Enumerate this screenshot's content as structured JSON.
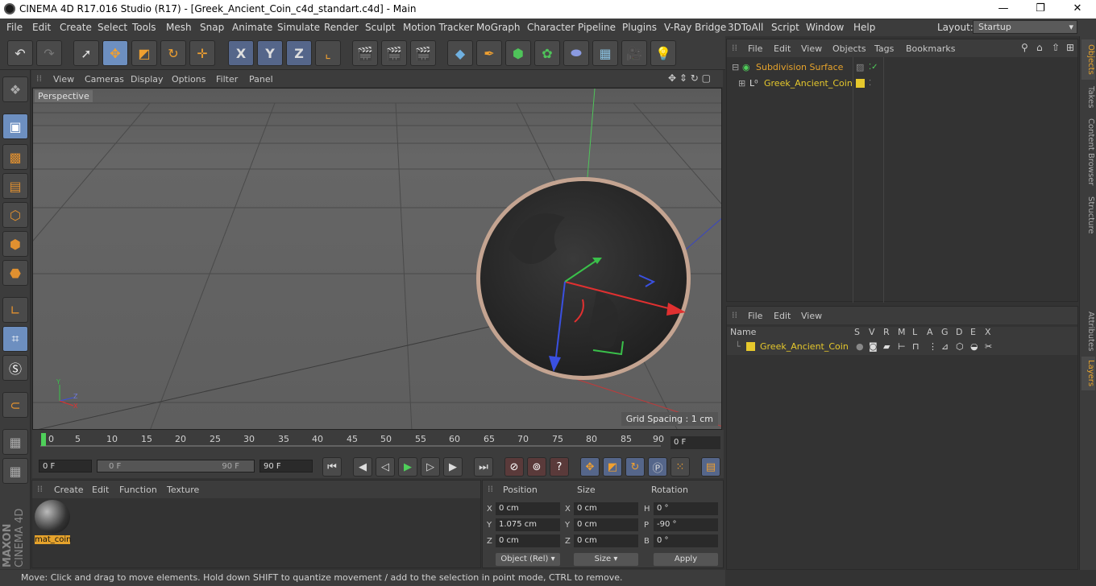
{
  "window": {
    "title": "CINEMA 4D R17.016 Studio (R17) - [Greek_Ancient_Coin_c4d_standart.c4d] - Main",
    "minimize": "—",
    "maximize": "❐",
    "close": "✕"
  },
  "menubar": {
    "items": [
      "File",
      "Edit",
      "Create",
      "Select",
      "Tools",
      "Mesh",
      "Snap",
      "Animate",
      "Simulate",
      "Render",
      "Sculpt",
      "Motion Tracker",
      "MoGraph",
      "Character",
      "Pipeline",
      "Plugins",
      "V-Ray Bridge",
      "3DToAll",
      "Script",
      "Window",
      "Help"
    ],
    "layout_label": "Layout:",
    "layout_value": "Startup"
  },
  "toolbar": {
    "undo": "↶",
    "redo": "↷",
    "axis_x": "X",
    "axis_y": "Y",
    "axis_z": "Z"
  },
  "viewport": {
    "menu": [
      "View",
      "Cameras",
      "Display",
      "Options",
      "Filter",
      "Panel"
    ],
    "label": "Perspective",
    "grid_spacing": "Grid Spacing : 1 cm",
    "axis_y": "Y",
    "axis_z": "Z",
    "axis_x": "X"
  },
  "timeline": {
    "ticks": [
      "0",
      "5",
      "10",
      "15",
      "20",
      "25",
      "30",
      "35",
      "40",
      "45",
      "50",
      "55",
      "60",
      "65",
      "70",
      "75",
      "80",
      "85",
      "90"
    ],
    "current_frame": "0 F"
  },
  "transport": {
    "start_field": "0 F",
    "range_start": "0 F",
    "range_end": "90 F",
    "end_field": "90 F"
  },
  "material_manager": {
    "menu": [
      "Create",
      "Edit",
      "Function",
      "Texture"
    ],
    "material_name": "mat_coin"
  },
  "coordinates": {
    "headers": {
      "position": "Position",
      "size": "Size",
      "rotation": "Rotation"
    },
    "pos_x": "0 cm",
    "pos_y": "1.075 cm",
    "pos_z": "0 cm",
    "size_x": "0 cm",
    "size_y": "0 cm",
    "size_z": "0 cm",
    "rot_h": "0 °",
    "rot_p": "-90 °",
    "rot_b": "0 °",
    "labels": {
      "x": "X",
      "y": "Y",
      "z": "Z",
      "h": "H",
      "p": "P",
      "b": "B"
    },
    "mode": "Object (Rel)",
    "size_mode": "Size",
    "apply": "Apply"
  },
  "status": {
    "text": "Move: Click and drag to move elements. Hold down SHIFT to quantize movement / add to the selection in point mode, CTRL to remove."
  },
  "object_manager": {
    "menu": [
      "File",
      "Edit",
      "View",
      "Objects",
      "Tags",
      "Bookmarks"
    ],
    "objects": [
      {
        "name": "Subdivision Surface",
        "color": "#e6a32c"
      },
      {
        "name": "Greek_Ancient_Coin",
        "color": "#e6c82c"
      }
    ]
  },
  "layer_manager": {
    "menu": [
      "File",
      "Edit",
      "View"
    ],
    "columns": [
      "Name",
      "S",
      "V",
      "R",
      "M",
      "L",
      "A",
      "G",
      "D",
      "E",
      "X"
    ],
    "layers": [
      {
        "name": "Greek_Ancient_Coin",
        "color": "#e6c82c"
      }
    ]
  },
  "side_tabs": [
    "Objects",
    "Takes",
    "Content Browser",
    "Structure",
    "Attributes",
    "Layers"
  ],
  "branding": {
    "maxon": "MAXON",
    "cinema": "CINEMA 4D"
  }
}
